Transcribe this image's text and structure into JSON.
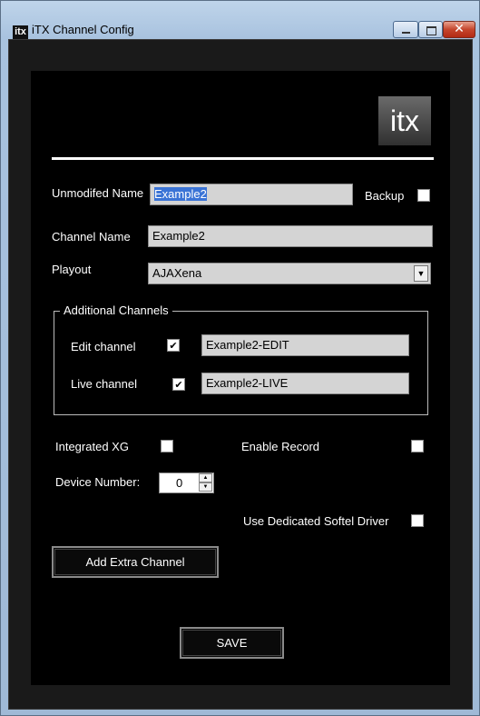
{
  "window": {
    "title": "iTX Channel Config",
    "icon_text": "itx",
    "controls": [
      "minimize",
      "maximize",
      "close"
    ]
  },
  "logo": {
    "text": "itx"
  },
  "form": {
    "unmodified_name_label": "Unmodifed Name",
    "unmodified_name_value": "Example2",
    "backup_label": "Backup",
    "backup_checked": false,
    "channel_name_label": "Channel Name",
    "channel_name_value": "Example2",
    "playout_label": "Playout",
    "playout_value": "AJAXena"
  },
  "additional_channels": {
    "legend": "Additional Channels",
    "edit_label": "Edit channel",
    "edit_checked": true,
    "edit_value": "Example2-EDIT",
    "live_label": "Live channel",
    "live_checked": true,
    "live_value": "Example2-LIVE"
  },
  "options": {
    "integrated_xg_label": "Integrated XG",
    "integrated_xg_checked": false,
    "enable_record_label": "Enable Record",
    "enable_record_checked": false,
    "device_number_label": "Device Number:",
    "device_number_value": "0",
    "softel_label": "Use Dedicated Softel Driver",
    "softel_checked": false
  },
  "buttons": {
    "add_extra_channel": "Add Extra Channel",
    "save": "SAVE"
  }
}
